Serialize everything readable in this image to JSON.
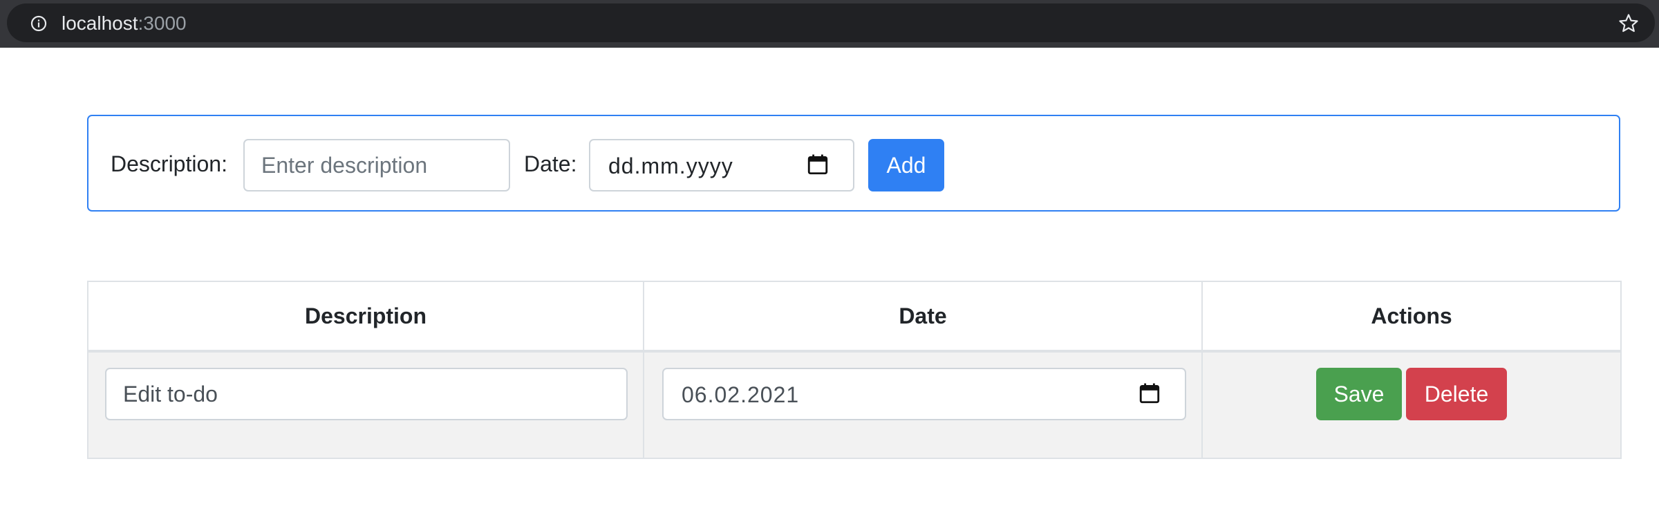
{
  "browser": {
    "url_host": "localhost",
    "url_port": ":3000",
    "icons": {
      "site_info": "info-icon",
      "bookmark": "star-icon"
    }
  },
  "form": {
    "description_label": "Description:",
    "description_placeholder": "Enter description",
    "description_value": "",
    "date_label": "Date:",
    "date_placeholder": "dd.mm.yyyy",
    "add_label": "Add"
  },
  "table": {
    "headers": [
      "Description",
      "Date",
      "Actions"
    ],
    "rows": [
      {
        "description": "Edit to-do",
        "date": "06.02.2021",
        "save_label": "Save",
        "delete_label": "Delete"
      }
    ]
  },
  "colors": {
    "primary": "#2f80f3",
    "success": "#4aa04f",
    "danger": "#d3414d",
    "row_stripe": "#f2f2f2"
  }
}
